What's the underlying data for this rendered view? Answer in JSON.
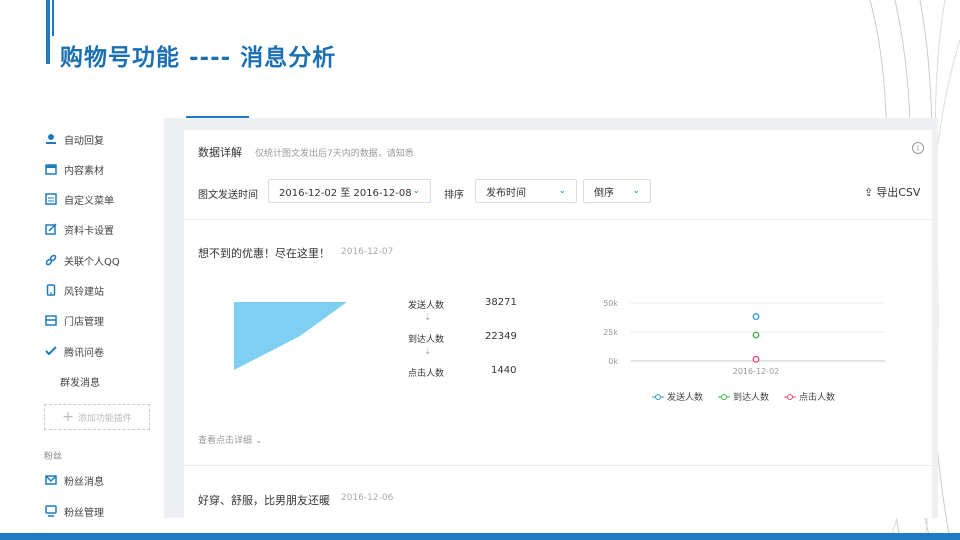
{
  "slide": {
    "title": "购物号功能 ----  消息分析"
  },
  "sidebar": {
    "items": [
      {
        "label": "自动回复",
        "icon": "robot-icon"
      },
      {
        "label": "内容素材",
        "icon": "folder-icon"
      },
      {
        "label": "自定义菜单",
        "icon": "menu-icon"
      },
      {
        "label": "资料卡设置",
        "icon": "edit-card-icon"
      },
      {
        "label": "关联个人QQ",
        "icon": "link-icon"
      },
      {
        "label": "风铃建站",
        "icon": "phone-icon"
      },
      {
        "label": "门店管理",
        "icon": "store-icon"
      },
      {
        "label": "腾讯问卷",
        "icon": "check-icon"
      }
    ],
    "plain_item": "群发消息",
    "add_plugin": "添加功能插件",
    "fans_section": "粉丝",
    "fans_items": [
      {
        "label": "粉丝消息",
        "icon": "mail-icon"
      },
      {
        "label": "粉丝管理",
        "icon": "user-icon"
      }
    ]
  },
  "detail": {
    "title": "数据详解",
    "subtitle": "仅统计图文发出后7天内的数据，请知悉",
    "info_icon": "i"
  },
  "filters": {
    "send_time_label": "图文发送时间",
    "date_range": "2016-12-02 至 2016-12-08",
    "sort_label": "排序",
    "sort_field": "发布时间",
    "sort_order": "倒序",
    "export_label": "导出CSV"
  },
  "articles": [
    {
      "title": "想不到的优惠！尽在这里！",
      "date": "2016-12-07",
      "funnel": [
        {
          "label": "发送人数",
          "value": "38271"
        },
        {
          "label": "到达人数",
          "value": "22349"
        },
        {
          "label": "点击人数",
          "value": "1440"
        }
      ],
      "view_more": "查看点击详细"
    },
    {
      "title": "好穿、舒服，比男朋友还暖",
      "date": "2016-12-06"
    }
  ],
  "colors": {
    "accent": "#1e7bc1",
    "funnel": "#7ecff2",
    "send": "#2d9fd8",
    "arrive": "#3cb54a",
    "click": "#e8476a"
  },
  "chart_data": {
    "type": "scatter",
    "x": [
      "2016-12-02"
    ],
    "series": [
      {
        "name": "发送人数",
        "values": [
          38271
        ]
      },
      {
        "name": "到达人数",
        "values": [
          22349
        ]
      },
      {
        "name": "点击人数",
        "values": [
          1440
        ]
      }
    ],
    "yticks": [
      "50k",
      "25k",
      "0k"
    ],
    "ylim": [
      0,
      50000
    ],
    "legend": "bottom",
    "grid": true
  }
}
